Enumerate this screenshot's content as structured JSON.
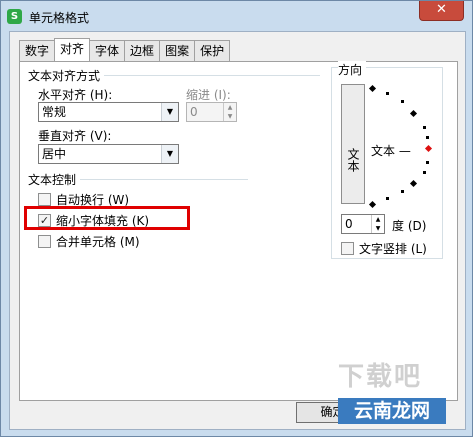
{
  "window": {
    "app_icon_letter": "S",
    "title": "单元格格式",
    "close_glyph": "✕"
  },
  "tabs": [
    "数字",
    "对齐",
    "字体",
    "边框",
    "图案",
    "保护"
  ],
  "active_tab": "对齐",
  "text_alignment": {
    "group_title": "文本对齐方式",
    "horizontal_label": "水平对齐 (H):",
    "horizontal_value": "常规",
    "indent_label": "缩进 (I):",
    "indent_value": "0",
    "vertical_label": "垂直对齐 (V):",
    "vertical_value": "居中"
  },
  "text_control": {
    "group_title": "文本控制",
    "wrap_text": {
      "label": "自动换行 (W)",
      "checked": false
    },
    "shrink_to_fit": {
      "label": "缩小字体填充 (K)",
      "checked": true
    },
    "merge_cells": {
      "label": "合并单元格 (M)",
      "checked": false
    }
  },
  "orientation": {
    "group_title": "方向",
    "vertical_text": "文本",
    "text_label": "文本 —",
    "degrees_value": "0",
    "degrees_label": "度 (D)",
    "vertical_stack_label": "文字竖排 (L)"
  },
  "buttons": {
    "ok": "确定"
  },
  "watermark": {
    "faint": "下载吧",
    "badge": "云南龙网"
  },
  "colors": {
    "highlight": "#e00000",
    "title_bar": "#c9dcee",
    "close_button": "#c84b3c"
  }
}
